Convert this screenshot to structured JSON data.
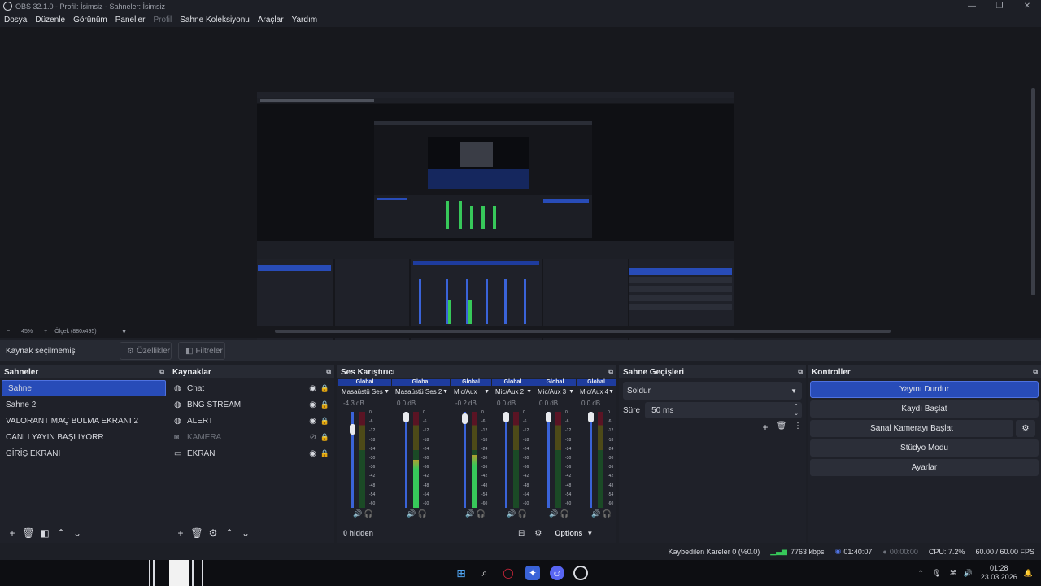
{
  "window": {
    "title": "OBS 32.1.0 - Profil: İsimsiz - Sahneler: İsimsiz"
  },
  "menu": [
    "Dosya",
    "Düzenle",
    "Görünüm",
    "Paneller",
    "Profil",
    "Sahne Koleksiyonu",
    "Araçlar",
    "Yardım"
  ],
  "zoom": {
    "minus": "−",
    "value": "45%",
    "plus": "+",
    "scale": "Ölçek (880x495)"
  },
  "context": {
    "no_source": "Kaynak seçilmemiş",
    "properties": "Özellikler",
    "filters": "Filtreler"
  },
  "scenes": {
    "title": "Sahneler",
    "items": [
      "Sahne",
      "Sahne 2",
      "VALORANT MAÇ BULMA EKRANI 2",
      "CANLI YAYIN BAŞLIYORR",
      "GİRİŞ EKRANI"
    ],
    "selected": 0
  },
  "sources": {
    "title": "Kaynaklar",
    "items": [
      {
        "name": "Chat",
        "icon": "browser-icon",
        "visible": true
      },
      {
        "name": "BNG STREAM",
        "icon": "browser-icon",
        "visible": true
      },
      {
        "name": "ALERT",
        "icon": "browser-icon",
        "visible": true
      },
      {
        "name": "KAMERA",
        "icon": "camera-icon",
        "visible": false
      },
      {
        "name": "EKRAN",
        "icon": "monitor-icon",
        "visible": true
      }
    ]
  },
  "mixer": {
    "title": "Ses Karıştırıcı",
    "global": "Global",
    "channels": [
      {
        "name": "Masaüstü Ses",
        "db": "-4.3 dB",
        "level": 0.0,
        "fader": 0.85
      },
      {
        "name": "Masaüstü Ses 2",
        "db": "0.0 dB",
        "level": 0.5,
        "fader": 1.0
      },
      {
        "name": "Mic/Aux",
        "db": "-0.2 dB",
        "level": 0.55,
        "fader": 0.98
      },
      {
        "name": "Mic/Aux 2",
        "db": "0.0 dB",
        "level": 0.0,
        "fader": 1.0
      },
      {
        "name": "Mic/Aux 3",
        "db": "0.0 dB",
        "level": 0.0,
        "fader": 1.0
      },
      {
        "name": "Mic/Aux 4",
        "db": "0.0 dB",
        "level": 0.0,
        "fader": 1.0
      }
    ],
    "ticks": [
      "0",
      "-6",
      "-12",
      "-18",
      "-24",
      "-30",
      "-36",
      "-42",
      "-48",
      "-54",
      "-60"
    ],
    "hidden": "0 hidden",
    "options": "Options"
  },
  "transitions": {
    "title": "Sahne Geçişleri",
    "selected": "Soldur",
    "duration_label": "Süre",
    "duration_value": "50 ms"
  },
  "controls": {
    "title": "Kontroller",
    "stop_stream": "Yayını Durdur",
    "start_record": "Kaydı Başlat",
    "virtual_cam": "Sanal Kamerayı Başlat",
    "studio_mode": "Stüdyo Modu",
    "settings": "Ayarlar"
  },
  "status": {
    "dropped": "Kaybedilen Kareler 0 (%0.0)",
    "bitrate": "7763 kbps",
    "stream_time": "01:40:07",
    "record_time": "00:00:00",
    "cpu": "CPU: 7.2%",
    "fps": "60.00 / 60.00 FPS"
  },
  "taskbar": {
    "time": "01:28",
    "date": "23.03.2026"
  },
  "colors": {
    "accent": "#284cb8",
    "meter_green": "#37c85a",
    "meter_yellow": "#b0a030",
    "meter_red": "#c0283e"
  }
}
